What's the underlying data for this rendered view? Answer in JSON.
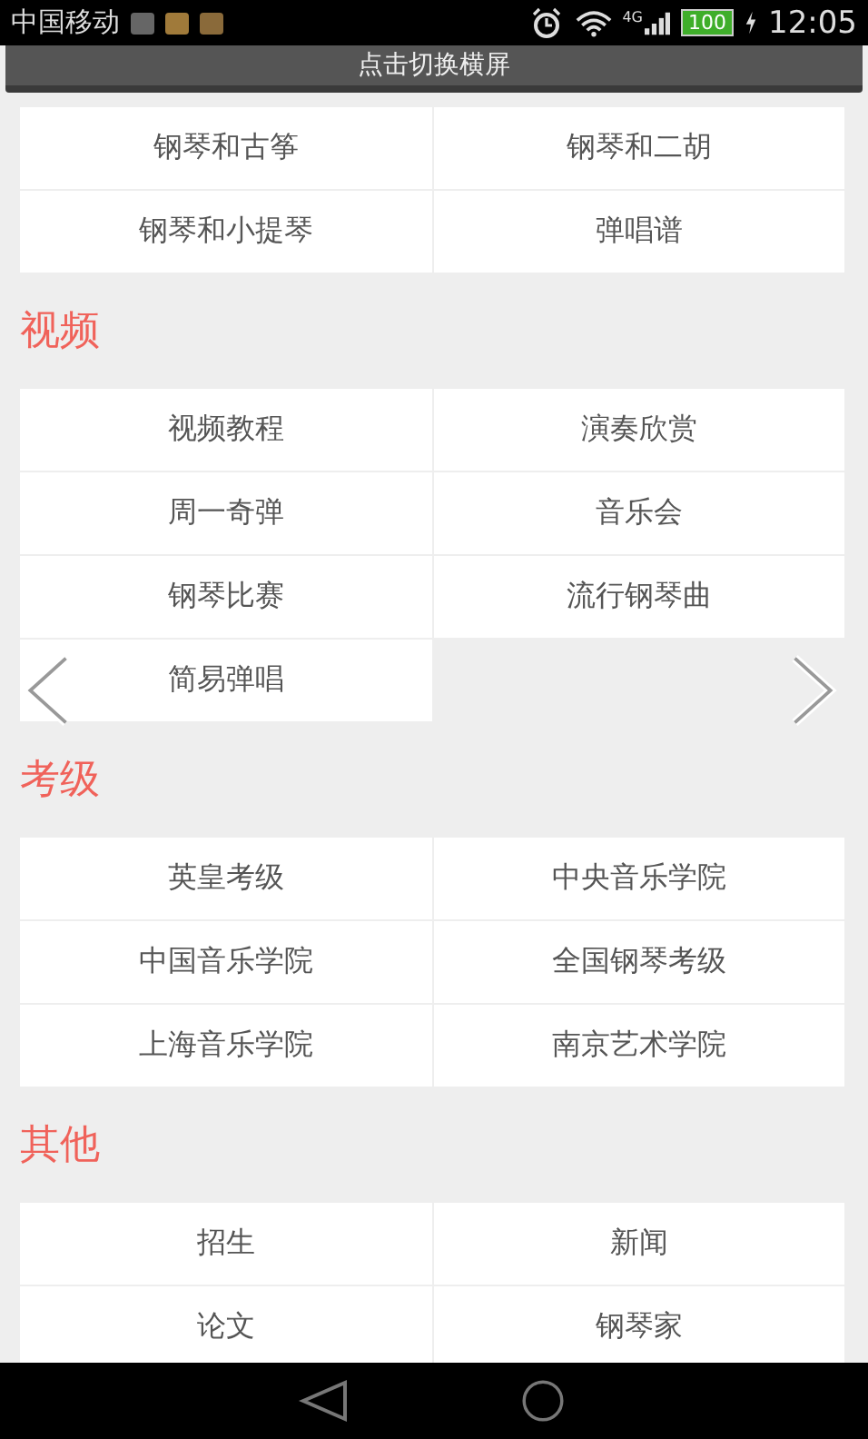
{
  "status_bar": {
    "carrier": "中国移动",
    "network": "4G",
    "battery": "100",
    "charging": true,
    "time": "12:05"
  },
  "header": {
    "label": "点击切换横屏"
  },
  "sections": [
    {
      "items": [
        "钢琴和古筝",
        "钢琴和二胡",
        "钢琴和小提琴",
        "弹唱谱"
      ]
    },
    {
      "heading": "视频",
      "items": [
        "视频教程",
        "演奏欣赏",
        "周一奇弹",
        "音乐会",
        "钢琴比赛",
        "流行钢琴曲",
        "简易弹唱"
      ]
    },
    {
      "heading": "考级",
      "items": [
        "英皇考级",
        "中央音乐学院",
        "中国音乐学院",
        "全国钢琴考级",
        "上海音乐学院",
        "南京艺术学院"
      ]
    },
    {
      "heading": "其他",
      "items": [
        "招生",
        "新闻",
        "论文",
        "钢琴家"
      ]
    }
  ]
}
